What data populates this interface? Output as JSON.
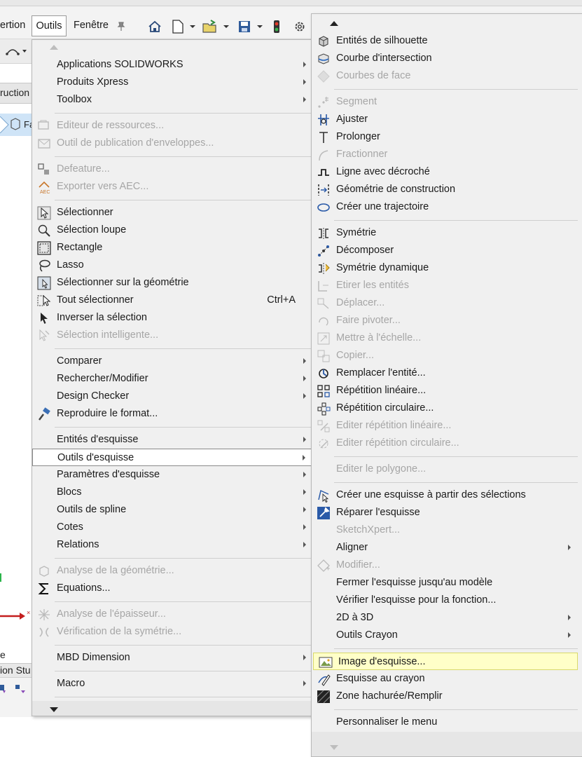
{
  "menubar": {
    "insertion_partial": "ertion",
    "outils": "Outils",
    "fenetre": "Fenêtre"
  },
  "left_pane": {
    "construction_partial": "ruction",
    "tree_partial": "Fa",
    "lower_text": "e",
    "lower_text2": "ion Stu"
  },
  "tools_menu": {
    "items": [
      {
        "label": "Applications SOLIDWORKS",
        "enabled": true,
        "submenu": true,
        "icon": ""
      },
      {
        "label": "Produits Xpress",
        "enabled": true,
        "submenu": true,
        "icon": ""
      },
      {
        "label": "Toolbox",
        "enabled": true,
        "submenu": true,
        "icon": ""
      },
      {
        "label": "Editeur de ressources...",
        "enabled": false,
        "submenu": false,
        "icon": "resource-editor-icon"
      },
      {
        "label": "Outil de publication d'enveloppes...",
        "enabled": false,
        "submenu": false,
        "icon": "envelope-publisher-icon"
      },
      {
        "label": "Defeature...",
        "enabled": false,
        "submenu": false,
        "icon": "defeature-icon"
      },
      {
        "label": "Exporter vers AEC...",
        "enabled": false,
        "submenu": false,
        "icon": "export-aec-icon"
      },
      {
        "label": "Sélectionner",
        "enabled": true,
        "submenu": false,
        "icon": "select-arrow-icon"
      },
      {
        "label": "Sélection loupe",
        "enabled": true,
        "submenu": false,
        "icon": "magnifier-select-icon"
      },
      {
        "label": "Rectangle",
        "enabled": true,
        "submenu": false,
        "icon": "rectangle-select-icon"
      },
      {
        "label": "Lasso",
        "enabled": true,
        "submenu": false,
        "icon": "lasso-icon"
      },
      {
        "label": "Sélectionner sur la géométrie",
        "enabled": true,
        "submenu": false,
        "icon": "select-over-geometry-icon"
      },
      {
        "label": "Tout sélectionner",
        "enabled": true,
        "submenu": false,
        "icon": "select-all-icon",
        "shortcut": "Ctrl+A"
      },
      {
        "label": "Inverser la sélection",
        "enabled": true,
        "submenu": false,
        "icon": "invert-selection-icon"
      },
      {
        "label": "Sélection intelligente...",
        "enabled": false,
        "submenu": false,
        "icon": "smart-selection-icon"
      },
      {
        "label": "Comparer",
        "enabled": true,
        "submenu": true,
        "icon": ""
      },
      {
        "label": "Rechercher/Modifier",
        "enabled": true,
        "submenu": true,
        "icon": ""
      },
      {
        "label": "Design Checker",
        "enabled": true,
        "submenu": true,
        "icon": ""
      },
      {
        "label": "Reproduire le format...",
        "enabled": true,
        "submenu": false,
        "icon": "format-painter-icon"
      },
      {
        "label": "Entités d'esquisse",
        "enabled": true,
        "submenu": true,
        "icon": ""
      },
      {
        "label": "Outils d'esquisse",
        "enabled": true,
        "submenu": true,
        "icon": "",
        "highlighted": true
      },
      {
        "label": "Paramètres d'esquisse",
        "enabled": true,
        "submenu": true,
        "icon": ""
      },
      {
        "label": "Blocs",
        "enabled": true,
        "submenu": true,
        "icon": ""
      },
      {
        "label": "Outils de spline",
        "enabled": true,
        "submenu": true,
        "icon": ""
      },
      {
        "label": "Cotes",
        "enabled": true,
        "submenu": true,
        "icon": ""
      },
      {
        "label": "Relations",
        "enabled": true,
        "submenu": true,
        "icon": ""
      },
      {
        "label": "Analyse de la géométrie...",
        "enabled": false,
        "submenu": false,
        "icon": "geometry-analysis-icon"
      },
      {
        "label": "Equations...",
        "enabled": true,
        "submenu": false,
        "icon": "sigma-icon"
      },
      {
        "label": "Analyse de l'épaisseur...",
        "enabled": false,
        "submenu": false,
        "icon": "thickness-analysis-icon"
      },
      {
        "label": "Vérification de la symétrie...",
        "enabled": false,
        "submenu": false,
        "icon": "symmetry-check-icon"
      },
      {
        "label": "MBD Dimension",
        "enabled": true,
        "submenu": true,
        "icon": ""
      },
      {
        "label": "Macro",
        "enabled": true,
        "submenu": true,
        "icon": ""
      }
    ]
  },
  "sketch_tools_menu": {
    "items": [
      {
        "label": "Entités de silhouette",
        "enabled": true,
        "submenu": false,
        "icon": "silhouette-entities-icon"
      },
      {
        "label": "Courbe d'intersection",
        "enabled": true,
        "submenu": false,
        "icon": "intersection-curve-icon"
      },
      {
        "label": "Courbes de face",
        "enabled": false,
        "submenu": false,
        "icon": "face-curves-icon"
      },
      {
        "label": "Segment",
        "enabled": false,
        "submenu": false,
        "icon": "segment-icon"
      },
      {
        "label": "Ajuster",
        "enabled": true,
        "submenu": false,
        "icon": "trim-icon"
      },
      {
        "label": "Prolonger",
        "enabled": true,
        "submenu": false,
        "icon": "extend-icon"
      },
      {
        "label": "Fractionner",
        "enabled": false,
        "submenu": false,
        "icon": "split-icon"
      },
      {
        "label": "Ligne avec décroché",
        "enabled": true,
        "submenu": false,
        "icon": "jog-line-icon"
      },
      {
        "label": "Géométrie de construction",
        "enabled": true,
        "submenu": false,
        "icon": "construction-geometry-icon"
      },
      {
        "label": "Créer une trajectoire",
        "enabled": true,
        "submenu": false,
        "icon": "make-path-icon"
      },
      {
        "label": "Symétrie",
        "enabled": true,
        "submenu": false,
        "icon": "mirror-icon"
      },
      {
        "label": "Décomposer",
        "enabled": true,
        "submenu": false,
        "icon": "explode-icon"
      },
      {
        "label": "Symétrie dynamique",
        "enabled": true,
        "submenu": false,
        "icon": "dynamic-mirror-icon"
      },
      {
        "label": "Etirer les entités",
        "enabled": false,
        "submenu": false,
        "icon": "stretch-icon"
      },
      {
        "label": "Déplacer...",
        "enabled": false,
        "submenu": false,
        "icon": "move-icon"
      },
      {
        "label": "Faire pivoter...",
        "enabled": false,
        "submenu": false,
        "icon": "rotate-icon"
      },
      {
        "label": "Mettre à l'échelle...",
        "enabled": false,
        "submenu": false,
        "icon": "scale-icon"
      },
      {
        "label": "Copier...",
        "enabled": false,
        "submenu": false,
        "icon": "copy-icon"
      },
      {
        "label": "Remplacer l'entité...",
        "enabled": true,
        "submenu": false,
        "icon": "replace-entity-icon"
      },
      {
        "label": "Répétition linéaire...",
        "enabled": true,
        "submenu": false,
        "icon": "linear-pattern-icon"
      },
      {
        "label": "Répétition circulaire...",
        "enabled": true,
        "submenu": false,
        "icon": "circular-pattern-icon"
      },
      {
        "label": "Editer répétition linéaire...",
        "enabled": false,
        "submenu": false,
        "icon": "edit-linear-pattern-icon"
      },
      {
        "label": "Editer répétition circulaire...",
        "enabled": false,
        "submenu": false,
        "icon": "edit-circular-pattern-icon"
      },
      {
        "label": "Editer le polygone...",
        "enabled": false,
        "submenu": false,
        "icon": ""
      },
      {
        "label": "Créer une esquisse à partir des sélections",
        "enabled": true,
        "submenu": false,
        "icon": "sketch-from-selections-icon"
      },
      {
        "label": "Réparer l'esquisse",
        "enabled": true,
        "submenu": false,
        "icon": "repair-sketch-icon"
      },
      {
        "label": "SketchXpert...",
        "enabled": false,
        "submenu": false,
        "icon": ""
      },
      {
        "label": "Aligner",
        "enabled": true,
        "submenu": true,
        "icon": ""
      },
      {
        "label": "Modifier...",
        "enabled": false,
        "submenu": false,
        "icon": "modify-icon"
      },
      {
        "label": "Fermer l'esquisse jusqu'au modèle",
        "enabled": true,
        "submenu": false,
        "icon": ""
      },
      {
        "label": "Vérifier l'esquisse pour la fonction...",
        "enabled": true,
        "submenu": false,
        "icon": ""
      },
      {
        "label": "2D à 3D",
        "enabled": true,
        "submenu": true,
        "icon": ""
      },
      {
        "label": "Outils Crayon",
        "enabled": true,
        "submenu": true,
        "icon": ""
      },
      {
        "label": "Image d'esquisse...",
        "enabled": true,
        "submenu": false,
        "icon": "sketch-picture-icon",
        "highlighted": true
      },
      {
        "label": "Esquisse au crayon",
        "enabled": true,
        "submenu": false,
        "icon": "pen-sketch-icon"
      },
      {
        "label": "Zone hachurée/Remplir",
        "enabled": true,
        "submenu": false,
        "icon": "hatch-fill-icon"
      },
      {
        "label": "Personnaliser le menu",
        "enabled": true,
        "submenu": false,
        "icon": ""
      }
    ]
  }
}
